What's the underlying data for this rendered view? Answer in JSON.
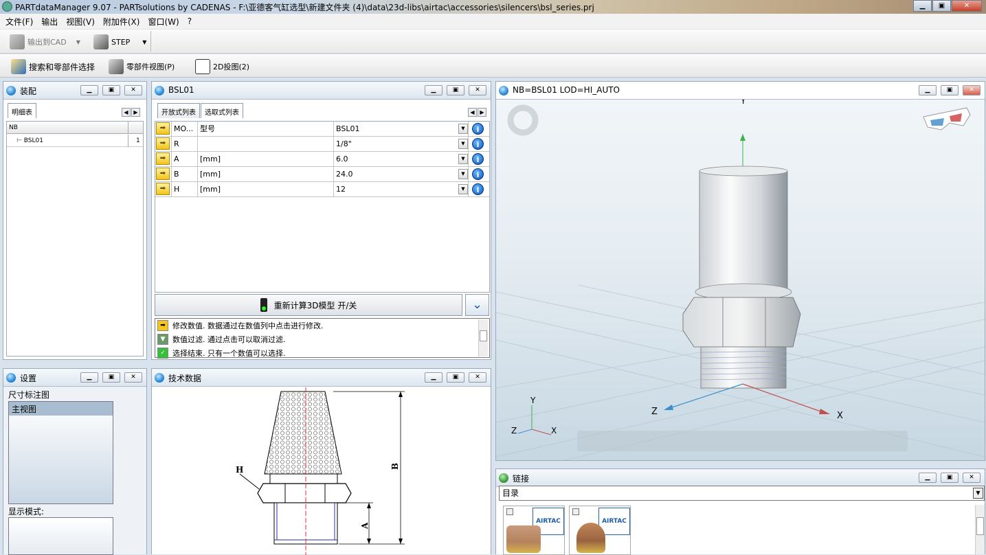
{
  "window": {
    "title": "PARTdataManager 9.07 - PARTsolutions by CADENAS - F:\\亚德客气缸选型\\新建文件夹 (4)\\data\\23d-libs\\airtac\\accessories\\silencers\\bsl_series.prj"
  },
  "menu": [
    "文件(F)",
    "输出",
    "视图(V)",
    "附加件(X)",
    "窗口(W)",
    "?"
  ],
  "toolbar1": {
    "export_cad": "输出到CAD",
    "step": "STEP"
  },
  "toolbar2": {
    "search": "搜索和零部件选择",
    "part_view": "零部件视图(P)",
    "proj2d": "2D投图(2)"
  },
  "assembly": {
    "title": "装配",
    "tab": "明细表",
    "header": "NB",
    "rows": [
      {
        "name": "BSL01",
        "qty": "1"
      }
    ]
  },
  "bsl": {
    "title": "BSL01",
    "tabs": [
      "开放式列表",
      "选取式列表"
    ],
    "rows": [
      {
        "name": "MO...",
        "desc": "型号",
        "value": "BSL01"
      },
      {
        "name": "R",
        "desc": "",
        "value": "1/8\""
      },
      {
        "name": "A",
        "desc": "[mm]",
        "value": "6.0"
      },
      {
        "name": "B",
        "desc": "[mm]",
        "value": "24.0"
      },
      {
        "name": "H",
        "desc": "[mm]",
        "value": "12"
      }
    ],
    "recalc": "重新计算3D模型 开/关",
    "messages": [
      "修改数值. 数据通过在数值列中点击进行修改.",
      "数值过滤. 通过点击可以取消过滤.",
      "选择结束. 只有一个数值可以选择."
    ]
  },
  "viewer": {
    "title": "NB=BSL01 LOD=HI_AUTO",
    "axes": {
      "x": "X",
      "y": "Y",
      "z": "Z"
    }
  },
  "settings": {
    "title": "设置",
    "dim_label": "尺寸标注图",
    "list": [
      "主视图"
    ],
    "display_mode": "显示模式:"
  },
  "techdata": {
    "title": "技术数据",
    "labels": {
      "h": "H",
      "b": "B",
      "a": "A"
    }
  },
  "links": {
    "title": "链接",
    "select": "目录",
    "brand": "AIRTAC"
  },
  "colors": {
    "accent": "#2b8ad6",
    "close": "#c0412c"
  }
}
